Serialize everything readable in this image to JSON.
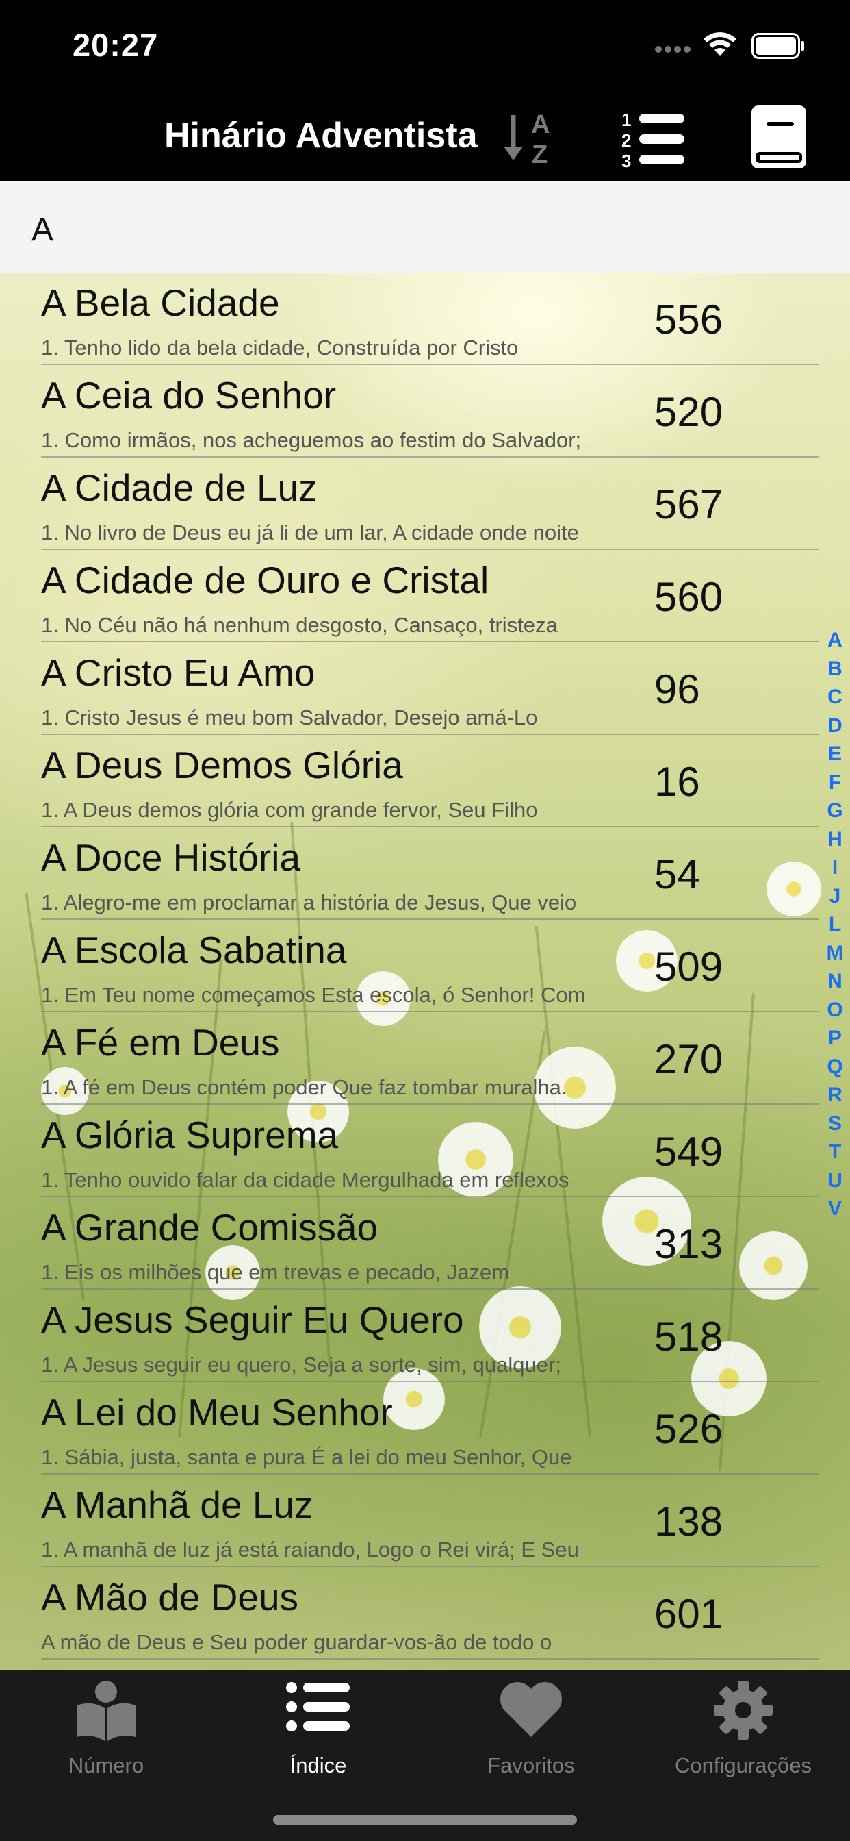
{
  "status_bar": {
    "time": "20:27",
    "icons": [
      "signal-icon",
      "wifi-icon",
      "battery-icon"
    ]
  },
  "nav": {
    "title": "Hinário Adventista",
    "buttons": [
      "sort-az-icon",
      "numbered-list-icon",
      "book-icon"
    ]
  },
  "section": {
    "header": "A"
  },
  "hymns": [
    {
      "title": "A Bela Cidade",
      "first_line": "1. Tenho lido da bela cidade, Construída por Cristo",
      "number": "556"
    },
    {
      "title": "A Ceia do Senhor",
      "first_line": "1. Como irmãos, nos acheguemos ao festim do Salvador;",
      "number": "520"
    },
    {
      "title": "A Cidade de Luz",
      "first_line": "1. No livro de Deus eu já li de um lar, A cidade onde noite",
      "number": "567"
    },
    {
      "title": "A Cidade de Ouro e Cristal",
      "first_line": "1. No Céu não há nenhum desgosto, Cansaço, tristeza",
      "number": "560"
    },
    {
      "title": "A Cristo Eu Amo",
      "first_line": "1. Cristo Jesus é meu bom Salvador, Desejo amá-Lo",
      "number": "96"
    },
    {
      "title": "A Deus Demos Glória",
      "first_line": "1. A Deus demos glória com grande fervor, Seu Filho",
      "number": "16"
    },
    {
      "title": "A Doce História",
      "first_line": "1. Alegro-me em proclamar a história de Jesus, Que veio",
      "number": "54"
    },
    {
      "title": "A Escola Sabatina",
      "first_line": "1. Em Teu nome começamos Esta escola, ó Senhor! Com",
      "number": "509"
    },
    {
      "title": "A Fé em Deus",
      "first_line": "1. A fé em Deus contém poder Que faz tombar muralha.",
      "number": "270"
    },
    {
      "title": "A Glória Suprema",
      "first_line": "1. Tenho ouvido falar da cidade Mergulhada em reflexos",
      "number": "549"
    },
    {
      "title": "A Grande Comissão",
      "first_line": "1. Eis os milhões que em trevas e pecado, Jazem",
      "number": "313"
    },
    {
      "title": "A Jesus Seguir Eu Quero",
      "first_line": "1. A Jesus seguir eu quero, Seja a sorte, sim, qualquer;",
      "number": "518"
    },
    {
      "title": "A Lei do Meu Senhor",
      "first_line": "1. Sábia, justa, santa e pura É a lei do meu Senhor, Que",
      "number": "526"
    },
    {
      "title": "A Manhã de Luz",
      "first_line": "1. A manhã de luz já está raiando, Logo o Rei virá; E Seu",
      "number": "138"
    },
    {
      "title": "A Mão de Deus",
      "first_line": "A mão de Deus e Seu poder guardar-vos-ão de todo o",
      "number": "601"
    }
  ],
  "section_index": [
    "A",
    "B",
    "C",
    "D",
    "E",
    "F",
    "G",
    "H",
    "I",
    "J",
    "L",
    "M",
    "N",
    "O",
    "P",
    "Q",
    "R",
    "S",
    "T",
    "U",
    "V"
  ],
  "colors": {
    "index_accent": "#1c6ff0",
    "tab_active": "#ffffff",
    "tab_inactive": "#7b7b7b",
    "bar_background": "#000000"
  },
  "tabs": [
    {
      "label": "Número",
      "icon": "open-book-icon",
      "active": false
    },
    {
      "label": "Índice",
      "icon": "list-icon",
      "active": true
    },
    {
      "label": "Favoritos",
      "icon": "heart-icon",
      "active": false
    },
    {
      "label": "Configurações",
      "icon": "gear-icon",
      "active": false
    }
  ]
}
